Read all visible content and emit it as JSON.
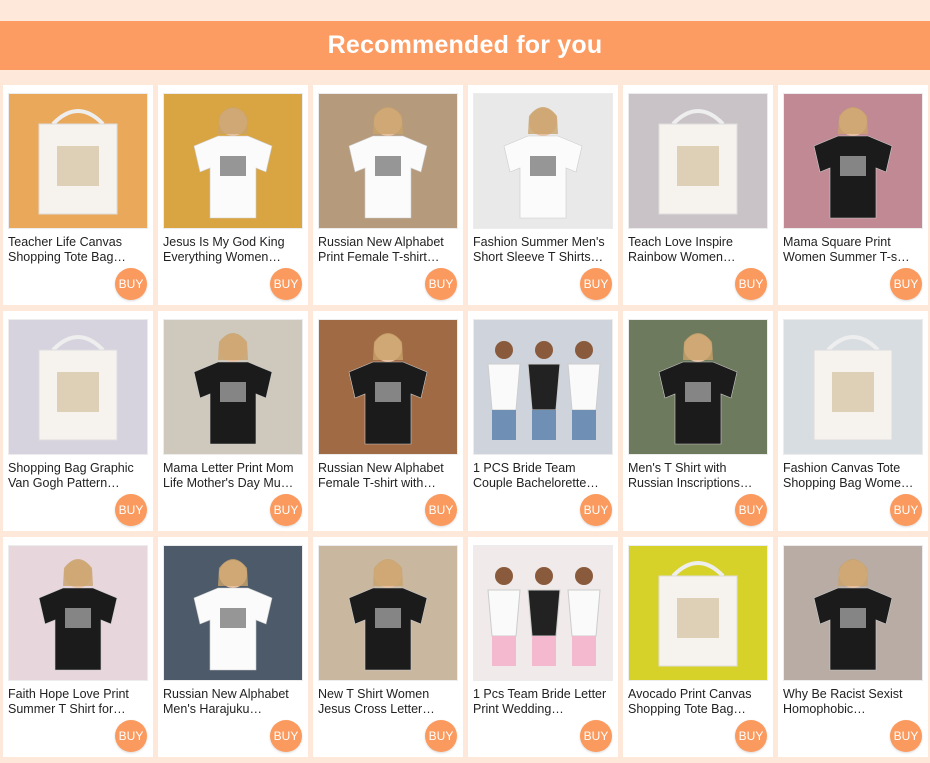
{
  "section": {
    "title": "Recommended for you"
  },
  "buy_label": "BUY",
  "colors": {
    "banner": "#fc9c63",
    "buy_button": "#fb9a5e",
    "background": "#fde8da"
  },
  "products": [
    {
      "title": "Teacher Life Canvas Shopping Tote Bag…",
      "image": "tote-bag-teacher-prints",
      "img_bg": "#e9a85a"
    },
    {
      "title": "Jesus Is My God King Everything Women…",
      "image": "white-tshirt-jesus-print",
      "img_bg": "#d9a542"
    },
    {
      "title": "Russian New Alphabet Print Female T-shirt…",
      "image": "white-tshirt-russian-alphabet",
      "img_bg": "#b59a7b"
    },
    {
      "title": "Fashion Summer Men's Short Sleeve T Shirts…",
      "image": "white-tshirt-doner-kebab",
      "img_bg": "#e9e9e9"
    },
    {
      "title": "Teach Love Inspire Rainbow Women…",
      "image": "tote-bag-rainbow-prints",
      "img_bg": "#c9c3c7"
    },
    {
      "title": "Mama Square Print Women Summer T-s…",
      "image": "black-tshirt-mama-square",
      "img_bg": "#c08993"
    },
    {
      "title": "Shopping Bag Graphic Van Gogh Pattern…",
      "image": "tote-bag-van-gogh",
      "img_bg": "#d6d3de"
    },
    {
      "title": "Mama Letter Print Mom Life Mother's Day Mu…",
      "image": "black-tshirt-mama-letter",
      "img_bg": "#cfc9bd"
    },
    {
      "title": "Russian New Alphabet Female T-shirt with…",
      "image": "black-tshirt-russian-alphabet",
      "img_bg": "#a06a45"
    },
    {
      "title": "1 PCS Bride Team Couple Bachelorette…",
      "image": "bride-team-tshirts",
      "img_bg": "#cfd4dc"
    },
    {
      "title": "Men's T Shirt with Russian Inscriptions…",
      "image": "black-tshirt-russian-inscription",
      "img_bg": "#6e7a5d"
    },
    {
      "title": "Fashion Canvas Tote Shopping Bag Wome…",
      "image": "tote-bag-quotes",
      "img_bg": "#d8dde2"
    },
    {
      "title": "Faith Hope Love Print Summer T Shirt for…",
      "image": "black-tshirt-faith-hope-love",
      "img_bg": "#e7d7dc"
    },
    {
      "title": "Russian New Alphabet Men's Harajuku…",
      "image": "white-tshirt-men-russian-alphabet",
      "img_bg": "#4c5a6a"
    },
    {
      "title": "New T Shirt Women Jesus Cross Letter…",
      "image": "black-tshirt-jesus-cross",
      "img_bg": "#c9b79f"
    },
    {
      "title": "1 Pcs Team Bride Letter Print Wedding…",
      "image": "team-bride-pink-skirts",
      "img_bg": "#f0eaea"
    },
    {
      "title": "Avocado Print Canvas Shopping Tote Bag…",
      "image": "tote-bag-avocado",
      "img_bg": "#d6d22a"
    },
    {
      "title": "Why Be Racist Sexist Homophobic…",
      "image": "black-tshirt-why-be-racist",
      "img_bg": "#b8aca4"
    }
  ]
}
